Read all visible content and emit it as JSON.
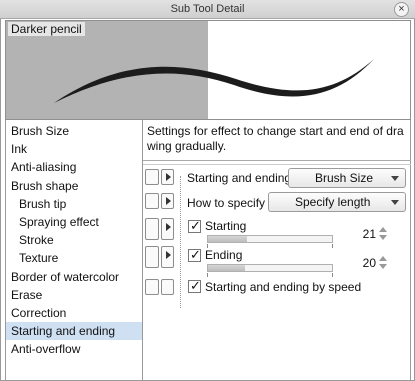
{
  "window": {
    "title": "Sub Tool Detail",
    "close_glyph": "×"
  },
  "preview": {
    "label": "Darker pencil"
  },
  "sidebar": {
    "items": [
      {
        "label": "Brush Size"
      },
      {
        "label": "Ink"
      },
      {
        "label": "Anti-aliasing"
      },
      {
        "label": "Brush shape"
      },
      {
        "label": "Brush tip"
      },
      {
        "label": "Spraying effect"
      },
      {
        "label": "Stroke"
      },
      {
        "label": "Texture"
      },
      {
        "label": "Border of watercolor"
      },
      {
        "label": "Erase"
      },
      {
        "label": "Correction"
      },
      {
        "label": "Starting and ending"
      },
      {
        "label": "Anti-overflow"
      }
    ]
  },
  "panel": {
    "description": "Settings for effect to change start and end of dra wing gradually.",
    "starting_and_ending": {
      "label": "Starting and ending",
      "value": "Brush Size"
    },
    "how_to_specify": {
      "label": "How to specify",
      "value": "Specify length"
    },
    "starting": {
      "label": "Starting",
      "value": "21",
      "checked": true,
      "level": 0.21
    },
    "ending": {
      "label": "Ending",
      "value": "20",
      "checked": true,
      "level": 0.2
    },
    "by_speed": {
      "label": "Starting and ending by speed",
      "checked": true
    }
  },
  "colors": {
    "selection": "#cfe0f2",
    "preview_gray": "#b3b3b3"
  },
  "check_glyph": "✓"
}
